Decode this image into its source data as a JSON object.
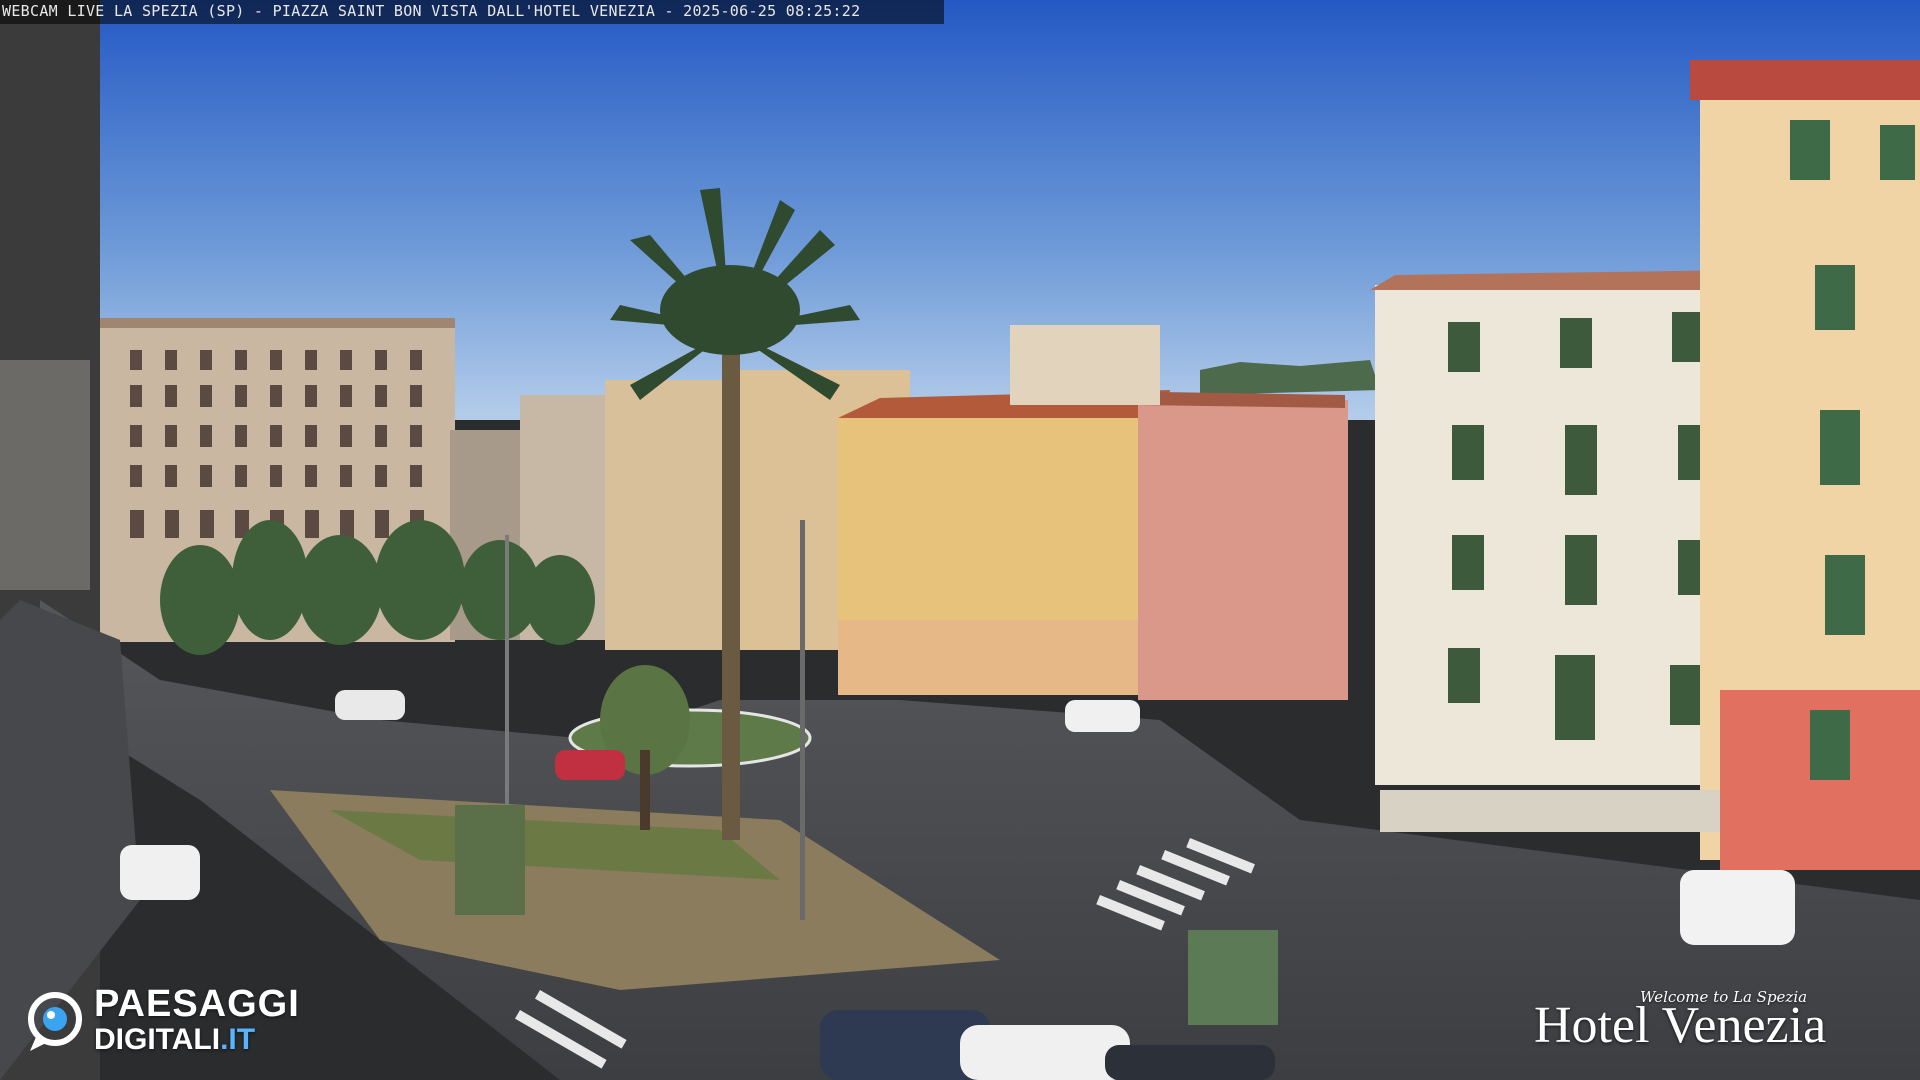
{
  "caption": "WEBCAM LIVE LA SPEZIA (SP) - PIAZZA SAINT BON VISTA DALL'HOTEL VENEZIA - 2025-06-25 08:25:22",
  "logos": {
    "paesaggi": {
      "line1": "PAESAGGI",
      "line2a": "DIGITALI",
      "line2b": ".IT"
    },
    "hotel": {
      "welcome": "Welcome to La Spezia",
      "name": "Hotel Venezia"
    }
  },
  "colors": {
    "sky_top": "#2a63c6",
    "sky_bottom": "#9fc0e6",
    "road": "#4a4c50",
    "palm": "#2f4a2e"
  }
}
